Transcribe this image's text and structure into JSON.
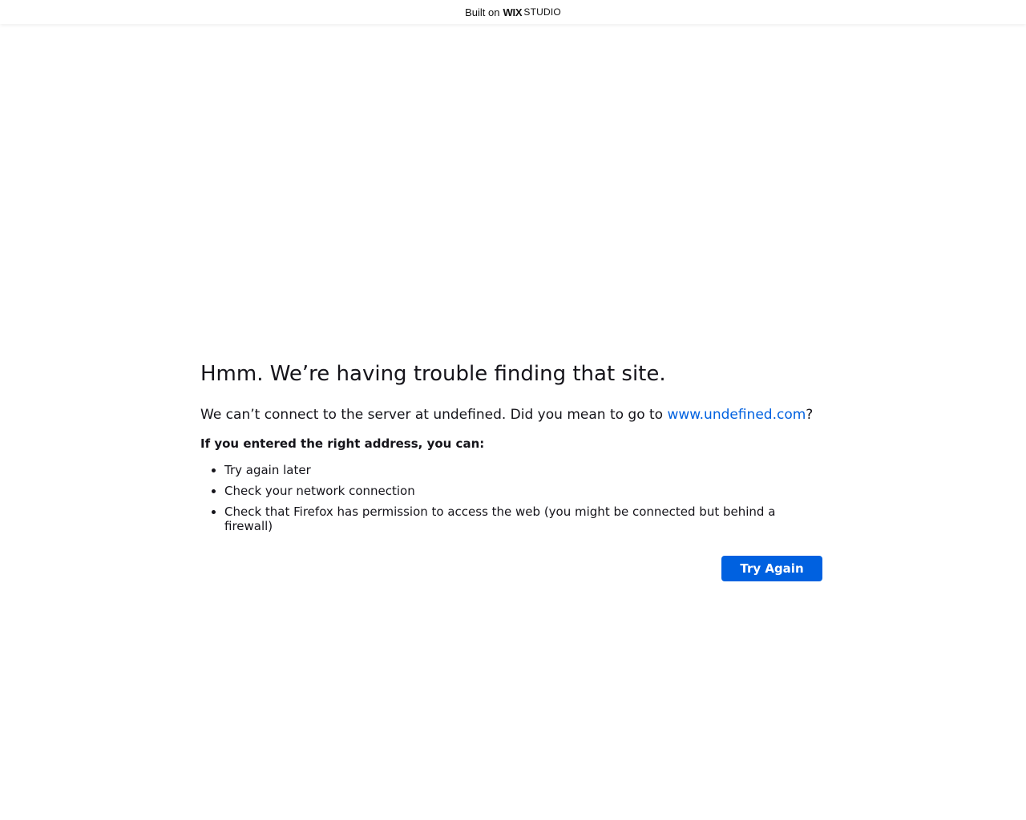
{
  "banner": {
    "built_on": "Built on",
    "brand_wix": "WIX",
    "brand_studio": "STUDIO"
  },
  "error": {
    "title": "Hmm. We’re having trouble finding that site.",
    "description_prefix": "We can’t connect to the server at undefined. Did you mean to go to ",
    "suggested_link": "www.undefined.com",
    "description_suffix": "?",
    "subheading": "If you entered the right address, you can:",
    "suggestions": [
      "Try again later",
      "Check your network connection",
      "Check that Firefox has permission to access the web (you might be connected but behind a firewall)"
    ],
    "try_again_label": "Try Again"
  },
  "colors": {
    "accent": "#0061e0",
    "text": "#15141a",
    "background": "#ffffff"
  }
}
